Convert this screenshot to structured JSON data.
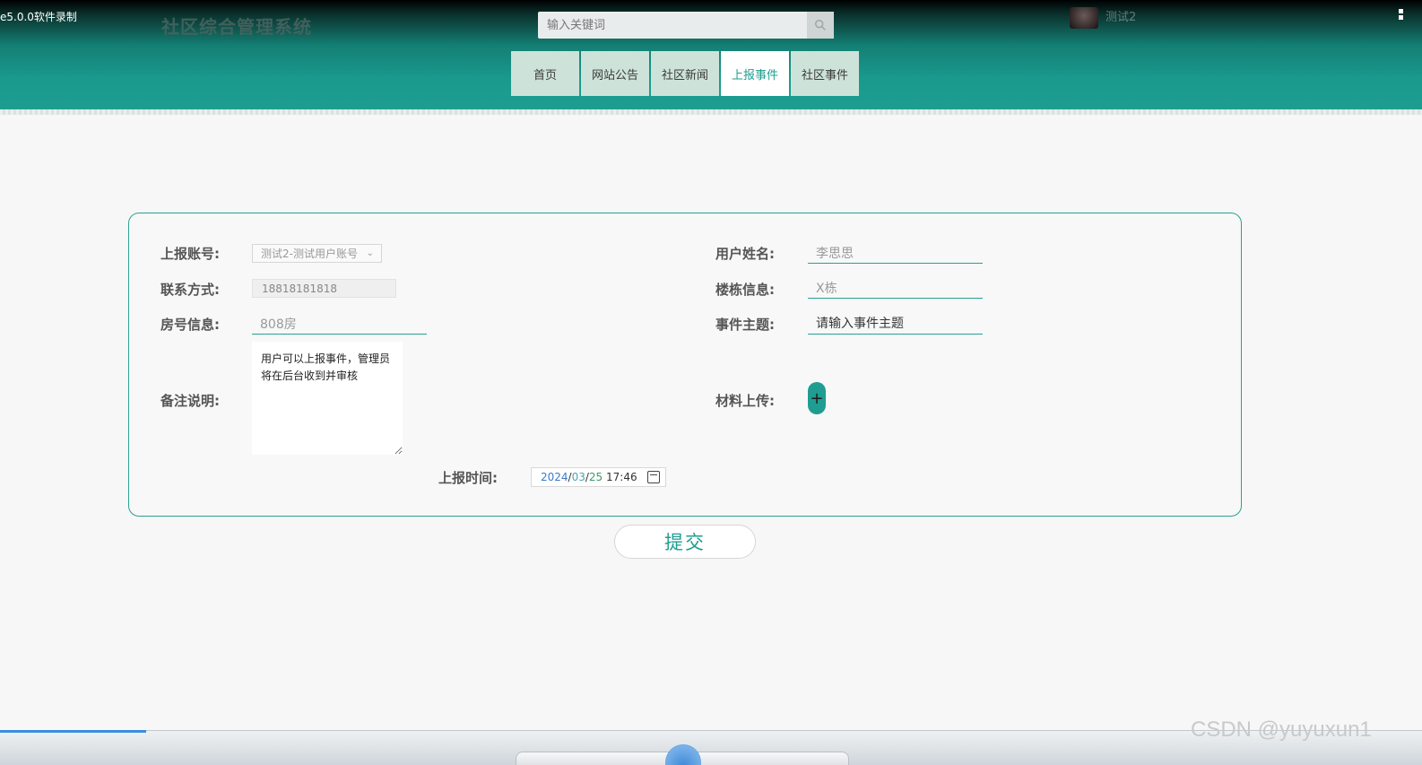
{
  "window": {
    "recorder_label": "e5.0.0软件录制"
  },
  "header": {
    "site_title": "社区综合管理系统",
    "search_placeholder": "输入关键词",
    "username": "测试2"
  },
  "nav": {
    "items": [
      {
        "label": "首页",
        "active": false
      },
      {
        "label": "网站公告",
        "active": false
      },
      {
        "label": "社区新闻",
        "active": false
      },
      {
        "label": "上报事件",
        "active": true
      },
      {
        "label": "社区事件",
        "active": false
      }
    ]
  },
  "form": {
    "account": {
      "label": "上报账号:",
      "value": "测试2-测试用户账号"
    },
    "username": {
      "label": "用户姓名:",
      "value": "李思思"
    },
    "contact": {
      "label": "联系方式:",
      "value": "18818181818"
    },
    "building": {
      "label": "楼栋信息:",
      "value": "X栋"
    },
    "room": {
      "label": "房号信息:",
      "value": "808房"
    },
    "subject": {
      "label": "事件主题:",
      "placeholder": "请输入事件主题"
    },
    "remarks": {
      "label": "备注说明:",
      "value": "用户可以上报事件，管理员将在后台收到并审核"
    },
    "upload": {
      "label": "材料上传:",
      "button": "+"
    },
    "report_time": {
      "label": "上报时间:",
      "year": "2024",
      "month": "03",
      "day": "25",
      "time": "17:46",
      "sep": "/"
    },
    "submit_label": "提交"
  },
  "watermark": "CSDN @yuyuxun1"
}
